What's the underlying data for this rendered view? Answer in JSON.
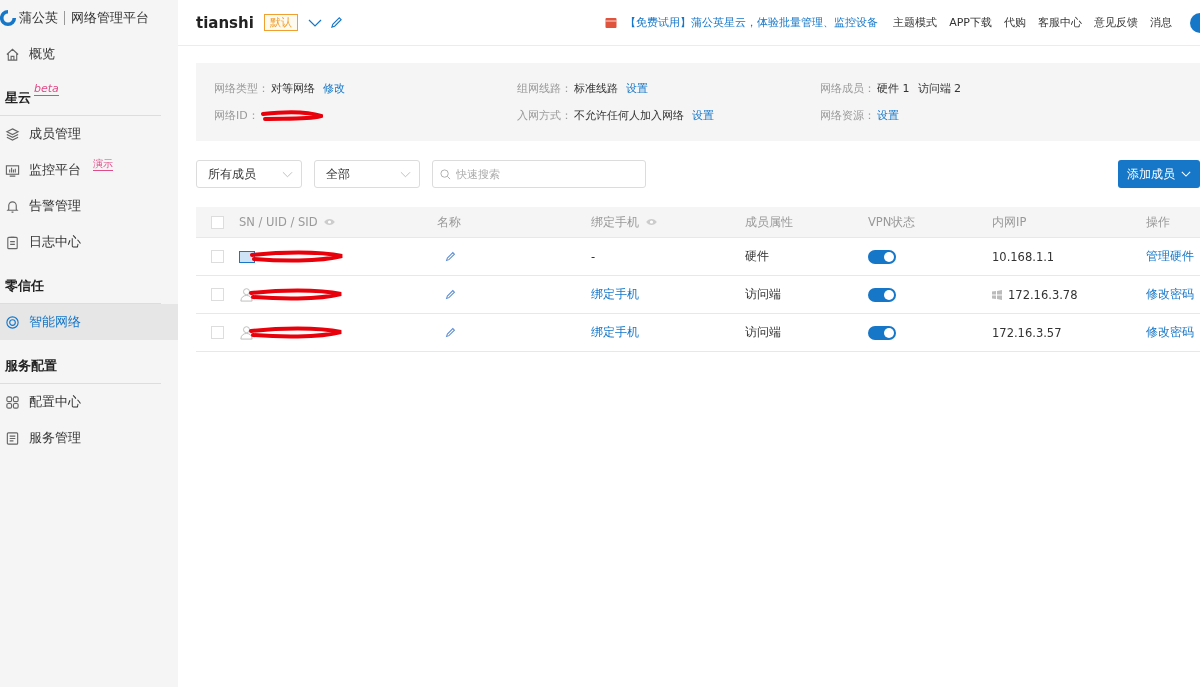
{
  "brand": {
    "name": "蒲公英",
    "product": "网络管理平台"
  },
  "sidebar": {
    "sections": [
      {
        "items": [
          {
            "label": "概览",
            "selected": false
          }
        ]
      },
      {
        "title": "星云",
        "tag": "beta",
        "items": [
          {
            "label": "成员管理",
            "selected": false
          },
          {
            "label": "监控平台",
            "tag": "演示",
            "selected": false
          },
          {
            "label": "告警管理",
            "selected": false
          },
          {
            "label": "日志中心",
            "selected": false
          }
        ]
      },
      {
        "title": "零信任",
        "items": [
          {
            "label": "智能网络",
            "selected": true
          }
        ]
      },
      {
        "title": "服务配置",
        "items": [
          {
            "label": "配置中心",
            "selected": false
          },
          {
            "label": "服务管理",
            "selected": false
          }
        ]
      }
    ]
  },
  "header": {
    "network_name": "tianshi",
    "badge": "默认",
    "promo": "【免费试用】蒲公英星云，体验批量管理、监控设备",
    "links": [
      "主题模式",
      "APP下载",
      "代购",
      "客服中心",
      "意见反馈",
      "消息"
    ]
  },
  "info": [
    {
      "label": "网络类型：",
      "value": "对等网络",
      "action": "修改"
    },
    {
      "label": "组网线路：",
      "value": "标准线路",
      "action": "设置"
    },
    {
      "label": "网络成员：",
      "value": "硬件 1",
      "value2": "访问端 2"
    },
    {
      "label": "网络ID：",
      "redacted": true
    },
    {
      "label": "入网方式：",
      "value": "不允许任何人加入网络",
      "action": "设置"
    },
    {
      "label": "网络资源：",
      "action": "设置"
    }
  ],
  "filters": {
    "member_select": "所有成员",
    "status_select": "全部",
    "search": {
      "placeholder": "快速搜索"
    },
    "add_button": "添加成员"
  },
  "table": {
    "select_all_checked": false,
    "columns": [
      "SN / UID / SID",
      "名称",
      "绑定手机",
      "成员属性",
      "VPN状态",
      "内网IP",
      "操作"
    ],
    "rows": [
      {
        "kind": "hardware",
        "checked": false,
        "sn_redacted": true,
        "phone": "-",
        "phone_link": false,
        "attr": "硬件",
        "vpn_on": true,
        "ip": "10.168.1.1",
        "windows_icon": false,
        "action": "管理硬件"
      },
      {
        "kind": "client",
        "checked": false,
        "sn_redacted": true,
        "phone": "绑定手机",
        "phone_link": true,
        "attr": "访问端",
        "vpn_on": true,
        "ip": "172.16.3.78",
        "windows_icon": true,
        "action": "修改密码"
      },
      {
        "kind": "client",
        "checked": false,
        "sn_redacted": true,
        "phone": "绑定手机",
        "phone_link": true,
        "attr": "访问端",
        "vpn_on": true,
        "ip": "172.16.3.57",
        "windows_icon": false,
        "action": "修改密码"
      }
    ]
  }
}
